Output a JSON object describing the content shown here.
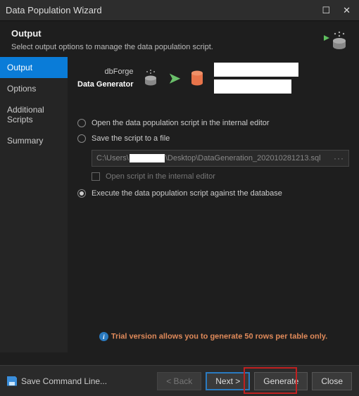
{
  "window": {
    "title": "Data Population Wizard"
  },
  "header": {
    "title": "Output",
    "desc": "Select output options to manage the data population script."
  },
  "sidebar": {
    "items": [
      {
        "label": "Output",
        "active": true
      },
      {
        "label": "Options",
        "active": false
      },
      {
        "label": "Additional Scripts",
        "active": false
      },
      {
        "label": "Summary",
        "active": false
      }
    ]
  },
  "connection": {
    "dbforge_label": "dbForge",
    "gen_label": "Data Generator"
  },
  "options": {
    "open_editor": "Open the data population script in the internal editor",
    "save_file": "Save the script to a file",
    "path_prefix": "C:\\Users\\",
    "path_suffix": "\\Desktop\\DataGeneration_202010281213.sql",
    "open_in_editor_chk": "Open script in the internal editor",
    "execute": "Execute the data population script against the database"
  },
  "trial_msg": "Trial version allows you to generate 50 rows per table only.",
  "footer": {
    "save_cmd": "Save Command Line...",
    "back": "< Back",
    "next": "Next >",
    "generate": "Generate",
    "close": "Close"
  }
}
